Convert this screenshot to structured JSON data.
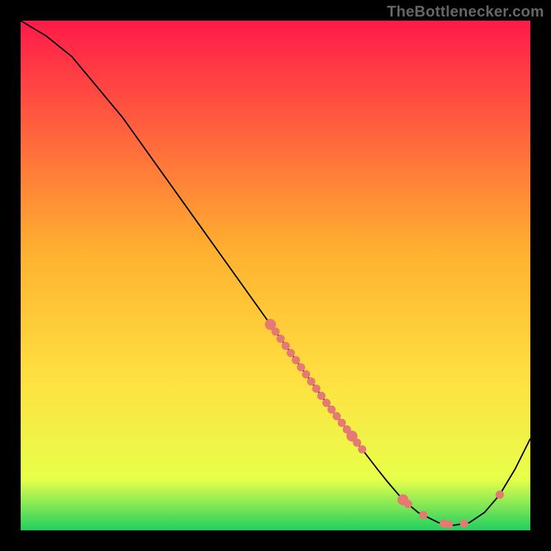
{
  "watermark": "TheBottlenecker.com",
  "colors": {
    "frame": "#000000",
    "grad_top": "#ff1a4a",
    "grad_mid_upper": "#ffb030",
    "grad_mid": "#ffe040",
    "grad_lower": "#e8ff4a",
    "grad_bottom": "#20d060",
    "curve": "#000000",
    "point": "#e47a72"
  },
  "chart_data": {
    "type": "line",
    "title": "",
    "xlabel": "",
    "ylabel": "",
    "xlim": [
      0,
      100
    ],
    "ylim": [
      0,
      100
    ],
    "curve": {
      "x": [
        0,
        5,
        10,
        15,
        20,
        25,
        30,
        35,
        40,
        45,
        50,
        55,
        60,
        65,
        70,
        72,
        75,
        78,
        82,
        85,
        88,
        91,
        94,
        97,
        100
      ],
      "y": [
        100,
        97,
        93,
        87,
        81,
        74,
        67,
        60,
        53,
        46,
        39,
        32,
        25,
        18.5,
        12,
        9.5,
        6,
        3.5,
        1.5,
        1,
        1.5,
        3.5,
        7,
        12,
        18
      ]
    },
    "points_on_curve_x": [
      49,
      50,
      51,
      52,
      53,
      54,
      55,
      56,
      57,
      58,
      59,
      60,
      61,
      62,
      63,
      64,
      65,
      66,
      67,
      75,
      76,
      79,
      83,
      84,
      87,
      94
    ],
    "point_radius_default": 6,
    "point_radius_overrides": {
      "49": 8,
      "65": 8,
      "75": 8
    }
  }
}
